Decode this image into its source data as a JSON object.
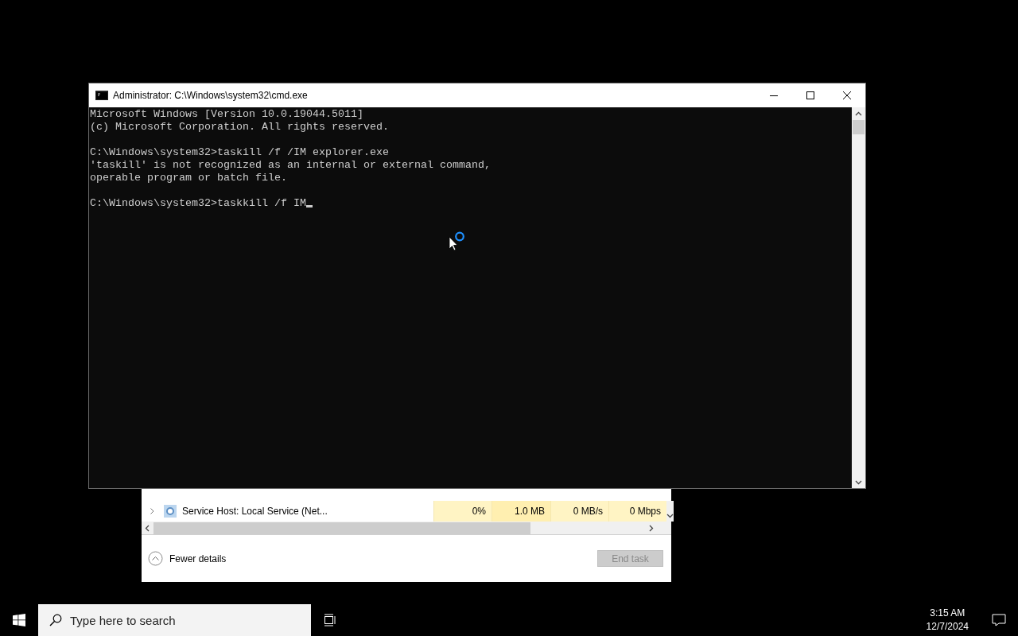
{
  "console_window": {
    "title": "Administrator: C:\\Windows\\system32\\cmd.exe",
    "blocks": [
      [
        "Microsoft Windows [Version 10.0.19044.5011]",
        "(c) Microsoft Corporation. All rights reserved."
      ],
      [
        "C:\\Windows\\system32>taskill /f /IM explorer.exe",
        "'taskill' is not recognized as an internal or external command,",
        "operable program or batch file."
      ],
      [
        "C:\\Windows\\system32>taskkill /f IM"
      ]
    ]
  },
  "task_manager": {
    "rows": [
      {
        "name": "Service Host: Local Service (Net...",
        "cpu": "0%",
        "memory": "1.0 MB",
        "disk": "0 MB/s",
        "network": "0 Mbps"
      }
    ],
    "fewer_details": "Fewer details",
    "end_task": {
      "label": "End task",
      "disabled": true
    }
  },
  "taskbar": {
    "search": {
      "placeholder": "Type here to search"
    },
    "time": "3:15 AM",
    "date": "12/7/2024"
  }
}
